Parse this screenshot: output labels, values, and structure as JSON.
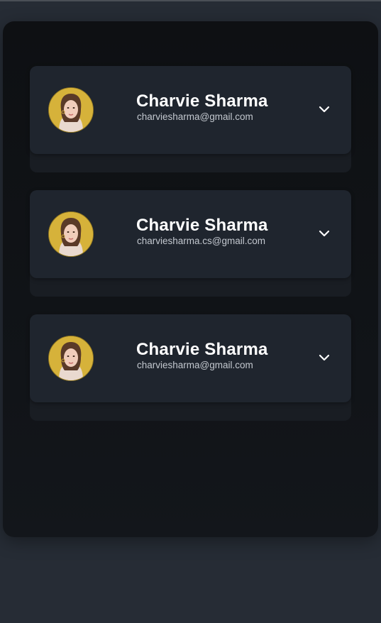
{
  "accounts": [
    {
      "name": "Charvie Sharma",
      "email": "charviesharma@gmail.com",
      "avatar_icon": "profile-photo",
      "expand_icon": "chevron-down-icon"
    },
    {
      "name": "Charvie Sharma",
      "email": "charviesharma.cs@gmail.com",
      "avatar_icon": "profile-photo",
      "expand_icon": "chevron-down-icon"
    },
    {
      "name": "Charvie Sharma",
      "email": "charviesharma@gmail.com",
      "avatar_icon": "profile-photo",
      "expand_icon": "chevron-down-icon"
    }
  ],
  "colors": {
    "page_background": "#262c35",
    "panel_background": "#0e1013",
    "card_background": "#1f252e",
    "name_text": "#ffffff",
    "email_text": "#c3c8cf",
    "avatar_background": "#d8b63a"
  }
}
